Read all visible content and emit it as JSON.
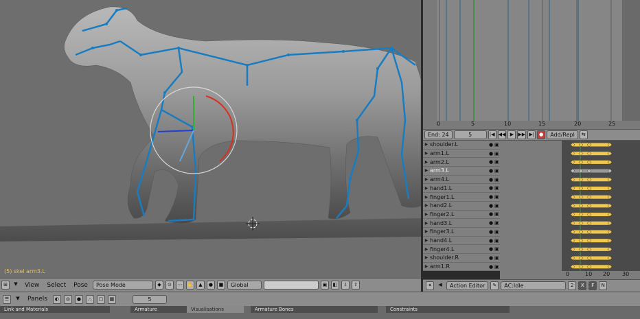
{
  "viewport": {
    "status_text": "(5) skel arm3.L"
  },
  "timeline": {
    "ruler_ticks": [
      "0",
      "5",
      "10",
      "15",
      "20",
      "25"
    ],
    "end_label": "End: 24",
    "current_frame": "5",
    "key_mode": "Add/Repl"
  },
  "channels": [
    {
      "label": "shoulder.L"
    },
    {
      "label": "arm1.L"
    },
    {
      "label": "arm2.L"
    },
    {
      "label": "arm3.L",
      "selected": true
    },
    {
      "label": "arm4.L"
    },
    {
      "label": "hand1.L"
    },
    {
      "label": "finger1.L"
    },
    {
      "label": "hand2.L"
    },
    {
      "label": "finger2.L"
    },
    {
      "label": "hand3.L"
    },
    {
      "label": "finger3.L"
    },
    {
      "label": "hand4.L"
    },
    {
      "label": "finger4.L"
    },
    {
      "label": "shoulder.R"
    },
    {
      "label": "arm1.R"
    }
  ],
  "keys_ruler": [
    "0",
    "10",
    "20",
    "30"
  ],
  "action_editor": {
    "editor_type": "Action Editor",
    "action_name": "AC:Idle",
    "users": "2",
    "x_btn": "X",
    "f_btn": "F",
    "extra": "N"
  },
  "vp_header": {
    "view": "View",
    "select": "Select",
    "pose": "Pose",
    "mode": "Pose Mode",
    "orientation": "Global"
  },
  "panels_header": {
    "label": "Panels",
    "frame": "5"
  },
  "panel_tabs": {
    "links": "Link and Materials",
    "armature": "Armature",
    "visualisations": "Visualisations",
    "armature_bones": "Armature Bones",
    "constraints": "Constraints"
  },
  "colors": {
    "viewport_bg": "#6e6e6e",
    "bone_blue": "#1a7cc0",
    "key_yellow": "#f0c850",
    "playhead_green": "#3c8c3c"
  }
}
